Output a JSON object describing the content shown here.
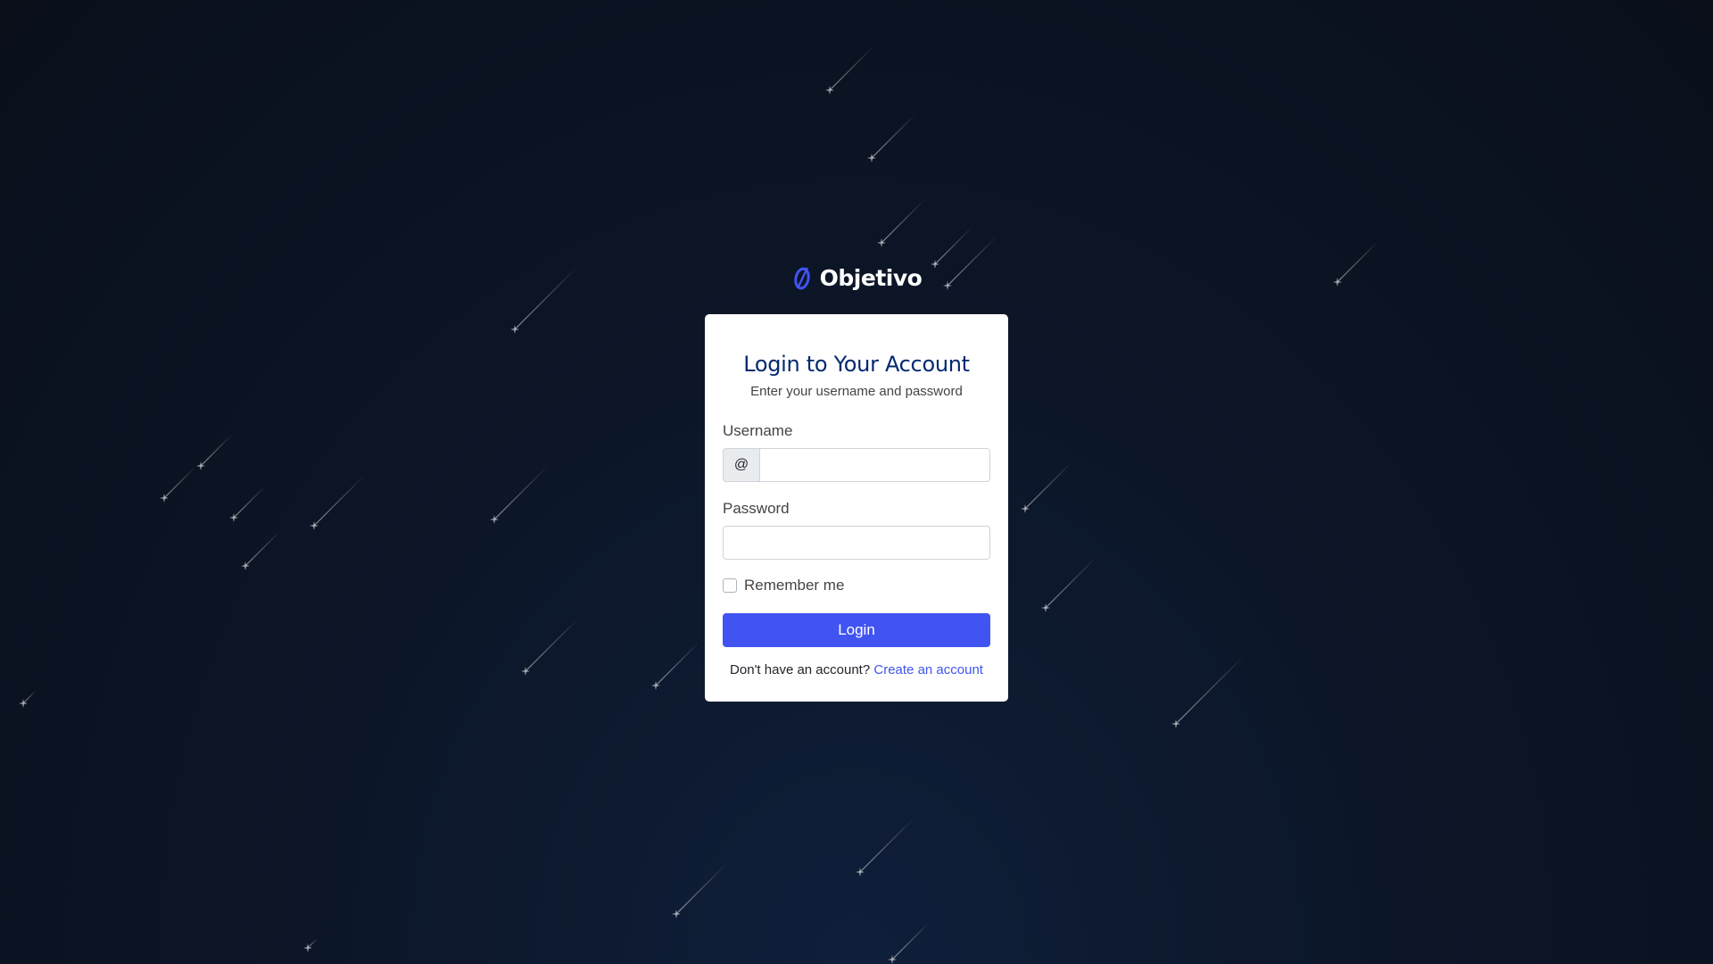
{
  "brand": {
    "name": "Objetivo",
    "logo_icon": "objetivo-logo-icon",
    "accent_color": "#4154f1"
  },
  "card": {
    "title": "Login to Your Account",
    "subtitle": "Enter your username and password"
  },
  "form": {
    "username_label": "Username",
    "username_prefix": "@",
    "username_value": "",
    "password_label": "Password",
    "password_value": "",
    "remember_label": "Remember me",
    "remember_checked": false,
    "login_label": "Login"
  },
  "signup": {
    "prompt": "Don't have an account?",
    "link_label": "Create an account"
  },
  "colors": {
    "title": "#012970",
    "button": "#4154f1",
    "background": "#0a0f1a"
  }
}
